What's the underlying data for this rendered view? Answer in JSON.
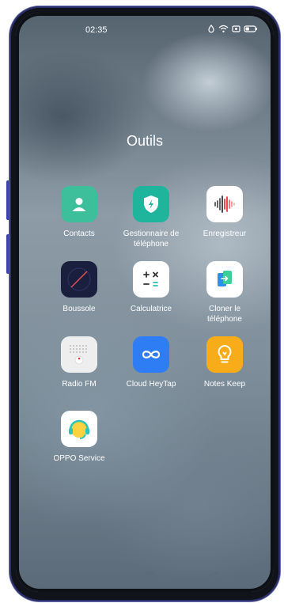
{
  "status_bar": {
    "time": "02:35",
    "icons": [
      "alarm-icon",
      "wifi-icon",
      "screen-record-icon",
      "battery-icon"
    ]
  },
  "folder": {
    "title": "Outils",
    "apps": [
      {
        "label": "Contacts",
        "icon": "contacts-icon",
        "color": "#3dbf9b"
      },
      {
        "label": "Gestionnaire de\ntéléphone",
        "icon": "phone-manager-icon",
        "color": "#1fb59c"
      },
      {
        "label": "Enregistreur",
        "icon": "recorder-icon",
        "color": "#ffffff"
      },
      {
        "label": "Boussole",
        "icon": "compass-icon",
        "color": "#1a1f3e"
      },
      {
        "label": "Calculatrice",
        "icon": "calculator-icon",
        "color": "#ffffff"
      },
      {
        "label": "Cloner le\ntéléphone",
        "icon": "clone-phone-icon",
        "color": "#ffffff"
      },
      {
        "label": "Radio FM",
        "icon": "radio-icon",
        "color": "#eeeeee"
      },
      {
        "label": "Cloud HeyTap",
        "icon": "cloud-heytap-icon",
        "color": "#2e7df5"
      },
      {
        "label": "Notes Keep",
        "icon": "notes-icon",
        "color": "#f9ac19"
      },
      {
        "label": "OPPO Service",
        "icon": "oppo-service-icon",
        "color": "#ffffff"
      }
    ]
  },
  "nav_bar": {
    "buttons": [
      "menu-icon",
      "home-icon",
      "back-icon"
    ]
  }
}
